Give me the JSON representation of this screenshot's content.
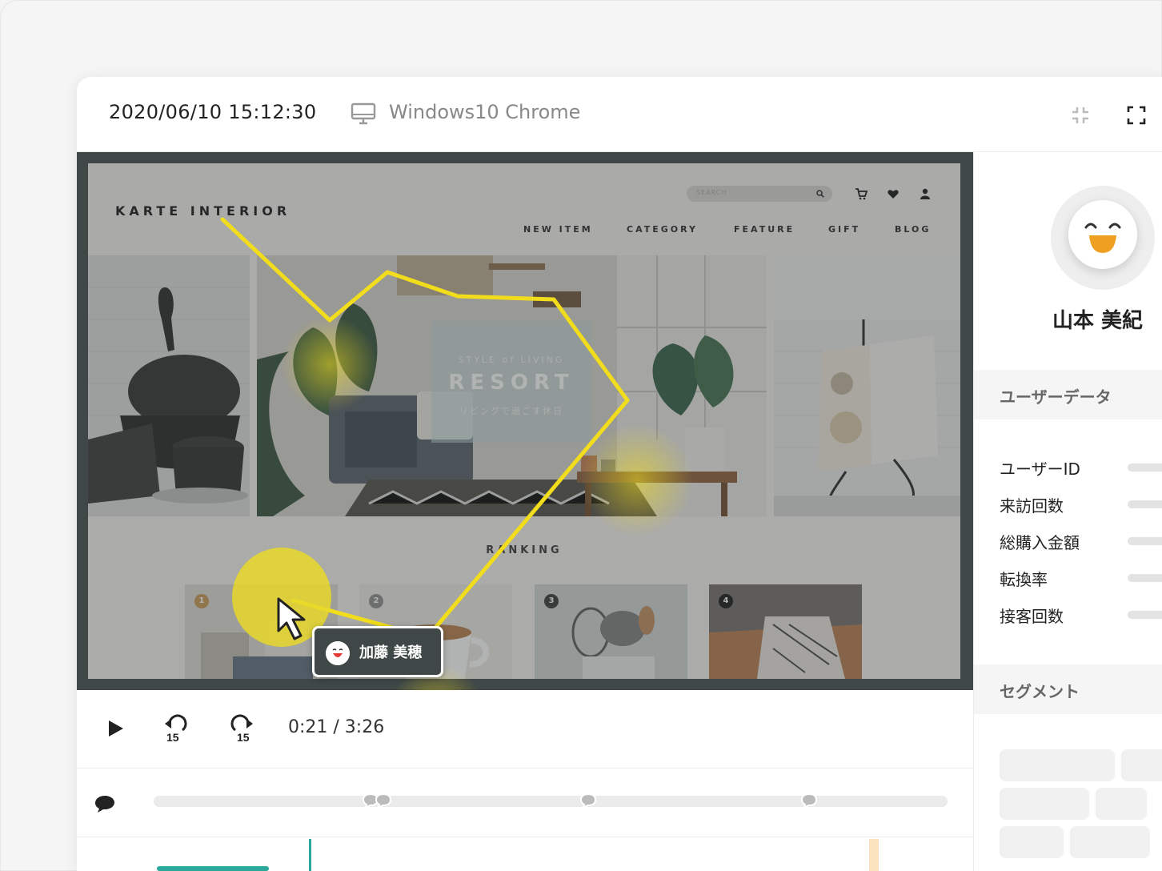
{
  "session": {
    "timestamp": "2020/06/10 15:12:30",
    "device": "Windows10 Chrome"
  },
  "site": {
    "logo": "KARTE INTERIOR",
    "search_placeholder": "SEARCH",
    "nav": [
      "NEW ITEM",
      "CATEGORY",
      "FEATURE",
      "GIFT",
      "BLOG"
    ],
    "hero": {
      "subtitle": "STYLE of LIVING",
      "title": "RESORT",
      "tagline": "リビングで過ごす休日"
    },
    "ranking_label": "RANKING",
    "ranking_badges": [
      "1",
      "2",
      "3",
      "4"
    ]
  },
  "overlay_user": {
    "name": "加藤 美穂"
  },
  "player": {
    "time": "0:21 / 3:26"
  },
  "user_panel": {
    "name": "山本 美紀",
    "user_data_title": "ユーザーデータ",
    "fields": [
      "ユーザーID",
      "来訪回数",
      "総購入金額",
      "転換率",
      "接客回数"
    ],
    "segment_title": "セグメント"
  },
  "colors": {
    "trail": "#f2dd1c",
    "player_bg": "#3f4847",
    "accent_teal": "#2aa89a",
    "accent_orange": "#f0a020"
  }
}
